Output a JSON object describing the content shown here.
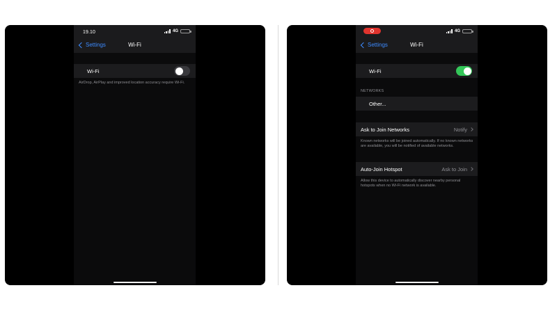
{
  "left": {
    "status": {
      "time": "19.10",
      "network": "4G",
      "battery_level": 1.0
    },
    "nav": {
      "back_label": "Settings",
      "title": "Wi-Fi"
    },
    "wifi": {
      "label": "Wi-Fi",
      "enabled": false
    },
    "footnote": "AirDrop, AirPlay and improved location accuracy require Wi-Fi."
  },
  "right": {
    "status": {
      "network": "4G",
      "battery_level": 1.0,
      "recording_indicator_color": "#e0342e"
    },
    "nav": {
      "back_label": "Settings",
      "title": "Wi-Fi"
    },
    "wifi": {
      "label": "Wi-Fi",
      "enabled": true
    },
    "networks_header": "NETWORKS",
    "other_label": "Other...",
    "ask_to_join": {
      "label": "Ask to Join Networks",
      "value": "Notify",
      "footnote": "Known networks will be joined automatically. If no known networks are available, you will be notified of available networks."
    },
    "auto_join": {
      "label": "Auto-Join Hotspot",
      "value": "Ask to Join",
      "footnote": "Allow this device to automatically discover nearby personal hotspots when no Wi-Fi network is available."
    }
  },
  "colors": {
    "accent": "#3d8bff",
    "toggle_on": "#34c759",
    "toggle_off": "#39393d",
    "cell_bg": "#1c1c1e",
    "secondary_text": "#8e8e93"
  },
  "icons": [
    "chevron-left-icon",
    "chevron-right-icon",
    "signal-icon",
    "battery-icon",
    "record-icon"
  ]
}
